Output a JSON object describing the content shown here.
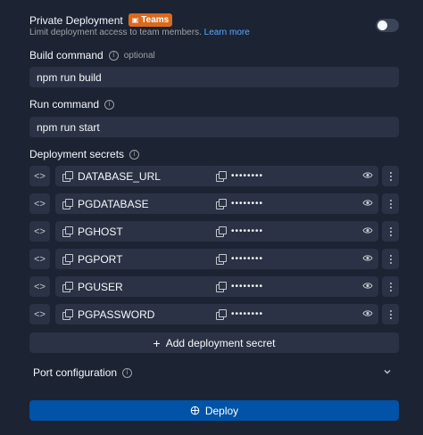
{
  "private_deployment": {
    "title": "Private Deployment",
    "badge_label": "Teams",
    "description": "Limit deployment access to team members.",
    "learn_more": "Learn more",
    "enabled": false
  },
  "build_command": {
    "label": "Build command",
    "optional": "optional",
    "value": "npm run build"
  },
  "run_command": {
    "label": "Run command",
    "value": "npm run start"
  },
  "secrets": {
    "label": "Deployment secrets",
    "masked_value": "••••••••",
    "items": [
      {
        "key": "DATABASE_URL"
      },
      {
        "key": "PGDATABASE"
      },
      {
        "key": "PGHOST"
      },
      {
        "key": "PGPORT"
      },
      {
        "key": "PGUSER"
      },
      {
        "key": "PGPASSWORD"
      }
    ],
    "add_label": "Add deployment secret"
  },
  "port_configuration": {
    "label": "Port configuration"
  },
  "deploy_button": {
    "label": "Deploy"
  },
  "colors": {
    "background": "#1c2333",
    "surface": "#2b3245",
    "accent": "#0053a6",
    "badge": "#db6a1e",
    "link": "#57abff"
  }
}
